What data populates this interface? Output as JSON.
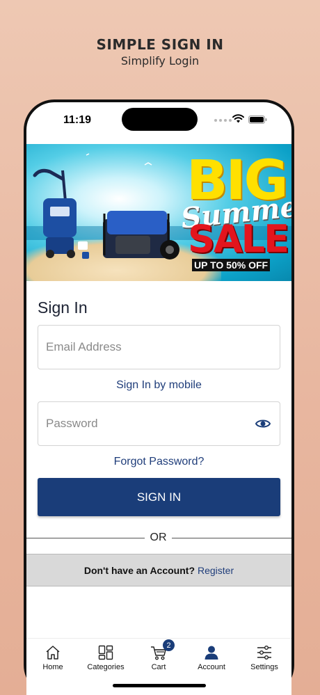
{
  "promo": {
    "title": "SIMPLE SIGN IN",
    "subtitle": "Simplify Login"
  },
  "status_bar": {
    "time": "11:19"
  },
  "banner": {
    "big": "BIG",
    "summer": "Summer",
    "sale": "SALE",
    "offer": "UP TO 50% OFF",
    "colors": {
      "big": "#ffe000",
      "sale": "#e3151d"
    }
  },
  "signin": {
    "heading": "Sign In",
    "email_placeholder": "Email Address",
    "mobile_link": "Sign In by mobile",
    "password_placeholder": "Password",
    "forgot_link": "Forgot Password?",
    "button_label": "SIGN IN",
    "or_label": "OR",
    "register_prompt": "Don't have an Account?",
    "register_link": "Register"
  },
  "tabbar": {
    "items": [
      {
        "label": "Home",
        "icon": "home-icon"
      },
      {
        "label": "Categories",
        "icon": "categories-icon"
      },
      {
        "label": "Cart",
        "icon": "cart-icon",
        "badge": "2"
      },
      {
        "label": "Account",
        "icon": "account-icon"
      },
      {
        "label": "Settings",
        "icon": "settings-icon"
      }
    ]
  },
  "colors": {
    "primary": "#1a3d79",
    "link": "#1f3d7a"
  }
}
